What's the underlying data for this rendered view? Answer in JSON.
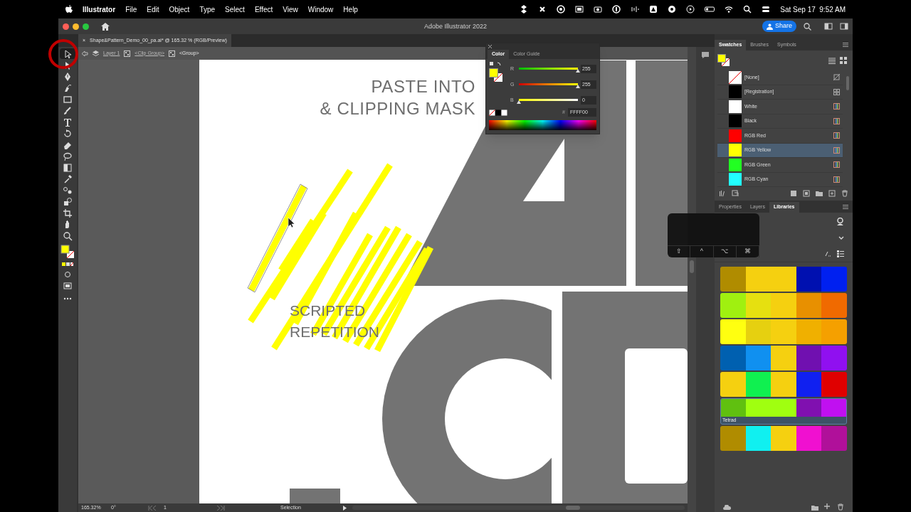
{
  "menu_bar": {
    "app": "Illustrator",
    "menus": [
      "File",
      "Edit",
      "Object",
      "Type",
      "Select",
      "Effect",
      "View",
      "Window",
      "Help"
    ],
    "clock": "Sat Sep 17  9:52 AM"
  },
  "window": {
    "title": "Adobe Illustrator 2022",
    "share": "Share"
  },
  "document_tab": {
    "title": "Shape&Pattern_Demo_00_pa.ai* @ 165.32 % (RGB/Preview)",
    "close": "×"
  },
  "breadcrumb": [
    "Layer 1",
    "<Clip Group>",
    "<Group>"
  ],
  "toolbar": {
    "tools": [
      {
        "selected": true
      },
      {
        "selected": false
      },
      {
        "selected": false
      },
      {
        "selected": false
      },
      {
        "selected": false
      },
      {
        "selected": false
      },
      {
        "selected": false
      },
      {
        "selected": false
      },
      {
        "selected": false
      },
      {
        "selected": false
      },
      {
        "selected": false
      },
      {
        "selected": false
      },
      {
        "selected": false
      },
      {
        "selected": false
      },
      {
        "selected": false
      },
      {
        "selected": false
      },
      {
        "selected": false
      }
    ]
  },
  "artboard": {
    "heading": [
      "PASTE INTO",
      "& CLIPPING MASK"
    ],
    "subheading": [
      "SCRIPTED",
      "REPETITION"
    ]
  },
  "color_panel": {
    "tabs": [
      {
        "label": "Color",
        "selected": true
      },
      {
        "label": "Color Guide",
        "selected": false
      }
    ],
    "channels": [
      {
        "name": "R",
        "level": 1,
        "reading": "255"
      },
      {
        "name": "G",
        "level": 1,
        "reading": "255"
      },
      {
        "name": "B",
        "level": 0,
        "reading": "0"
      }
    ],
    "hex_label": "#",
    "hex": "FFFF00"
  },
  "swatches_panel": {
    "tabs": [
      {
        "label": "Swatches",
        "selected": true
      },
      {
        "label": "Brushes",
        "selected": false
      },
      {
        "label": "Symbols",
        "selected": false
      }
    ],
    "swatches": [
      {
        "name": "[None]",
        "kind": "none",
        "color": "#ffffff",
        "selected": false
      },
      {
        "name": "[Registration]",
        "kind": "registration",
        "color": "#000000",
        "selected": false
      },
      {
        "name": "White",
        "kind": "process",
        "color": "#ffffff",
        "selected": false
      },
      {
        "name": "Black",
        "kind": "process",
        "color": "#000000",
        "selected": false
      },
      {
        "name": "RGB Red",
        "kind": "process",
        "color": "#ff0000",
        "selected": false
      },
      {
        "name": "RGB Yellow",
        "kind": "process",
        "color": "#ffff00",
        "selected": true
      },
      {
        "name": "RGB Green",
        "kind": "process",
        "color": "#22ff22",
        "selected": false
      },
      {
        "name": "RGB Cyan",
        "kind": "process",
        "color": "#22ffff",
        "selected": false
      }
    ]
  },
  "libraries_panel": {
    "tabs": [
      {
        "label": "Properties",
        "selected": false
      },
      {
        "label": "Layers",
        "selected": false
      },
      {
        "label": "Libraries",
        "selected": true
      }
    ],
    "themes": [
      {
        "chips": [
          {
            "color": "#b08c00"
          },
          {
            "color": "#f5d010"
          },
          {
            "color": "#f5d010"
          },
          {
            "color": "#0010b0"
          },
          {
            "color": "#0020f0"
          }
        ]
      },
      {
        "chips": [
          {
            "color": "#a0f010"
          },
          {
            "color": "#e6e010"
          },
          {
            "color": "#f5d010"
          },
          {
            "color": "#e89000"
          },
          {
            "color": "#f06a00"
          }
        ]
      },
      {
        "chips": [
          {
            "color": "#ffff10"
          },
          {
            "color": "#e6d010"
          },
          {
            "color": "#f5d010"
          },
          {
            "color": "#f0b000"
          },
          {
            "color": "#f5a000"
          }
        ]
      },
      {
        "chips": [
          {
            "color": "#0060b0"
          },
          {
            "color": "#1090f0"
          },
          {
            "color": "#f5d010"
          },
          {
            "color": "#7010b0"
          },
          {
            "color": "#9010f0"
          }
        ]
      },
      {
        "chips": [
          {
            "color": "#f5d010"
          },
          {
            "color": "#10f050"
          },
          {
            "color": "#f5d010"
          },
          {
            "color": "#1020f0"
          },
          {
            "color": "#e00000"
          }
        ]
      },
      {
        "chips": [
          {
            "color": "#60c010"
          },
          {
            "color": "#a0ff10"
          },
          {
            "color": "#a0ff10"
          },
          {
            "color": "#8010b0"
          },
          {
            "color": "#c010f0"
          }
        ],
        "label": "Tetrad"
      },
      {
        "chips": [
          {
            "color": "#b08c00"
          },
          {
            "color": "#10f0f0"
          },
          {
            "color": "#f5d010"
          },
          {
            "color": "#f010d0"
          },
          {
            "color": "#b0109a"
          }
        ]
      }
    ]
  },
  "keyboard_overlay": {
    "keys": [
      "⇧",
      "^",
      "⌥",
      "⌘"
    ]
  },
  "status_bar": {
    "zoom": "165.32%",
    "rotation": "0°",
    "artboard": "1",
    "tool": "Selection"
  }
}
